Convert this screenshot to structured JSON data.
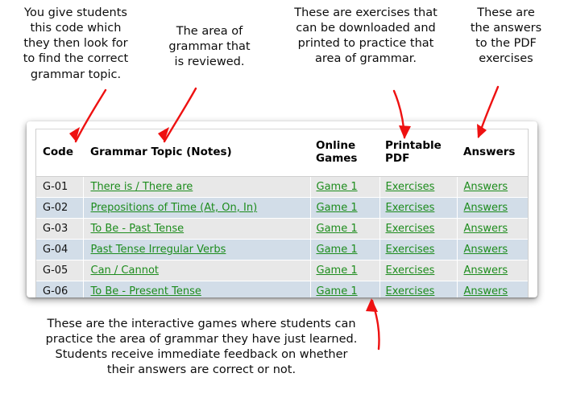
{
  "annotations": {
    "code": "You give students\nthis code which\nthey then look for\nto find the correct\ngrammar topic.",
    "topic": "The area of\ngrammar that\nis reviewed.",
    "printable_pdf": "These are exercises that\ncan be downloaded and\nprinted to practice that\narea of grammar.",
    "answers": "These are\nthe answers\nto the PDF\nexercises",
    "online_games": "These are the interactive games where students can\npractice the area of grammar they have just learned.\nStudents receive immediate feedback on whether\ntheir answers are correct or not.",
    "arrow_color": "#ee1111"
  },
  "table": {
    "headers": {
      "code": "Code",
      "topic": "Grammar Topic (Notes)",
      "games": "Online\nGames",
      "pdf": "Printable\nPDF",
      "answers": "Answers"
    },
    "link_labels": {
      "game": "Game 1",
      "pdf": "Exercises",
      "answers": "Answers"
    },
    "colors": {
      "link_green": "#1d8c1d",
      "row_gray": "#e8e8e8",
      "row_blue": "#d2dde8",
      "header_bg": "#ffffff"
    },
    "rows": [
      {
        "code": "G-01",
        "topic": "There is / There are",
        "game": "Game 1",
        "pdf": "Exercises",
        "answers": "Answers"
      },
      {
        "code": "G-02",
        "topic": "Prepositions of Time (At, On, In)",
        "game": "Game 1",
        "pdf": "Exercises",
        "answers": "Answers"
      },
      {
        "code": "G-03",
        "topic": "To Be - Past Tense",
        "game": "Game 1",
        "pdf": "Exercises",
        "answers": "Answers"
      },
      {
        "code": "G-04",
        "topic": "Past Tense Irregular Verbs",
        "game": "Game 1",
        "pdf": "Exercises",
        "answers": "Answers"
      },
      {
        "code": "G-05",
        "topic": "Can / Cannot",
        "game": "Game 1",
        "pdf": "Exercises",
        "answers": "Answers"
      },
      {
        "code": "G-06",
        "topic": "To Be - Present Tense",
        "game": "Game 1",
        "pdf": "Exercises",
        "answers": "Answers"
      }
    ]
  }
}
